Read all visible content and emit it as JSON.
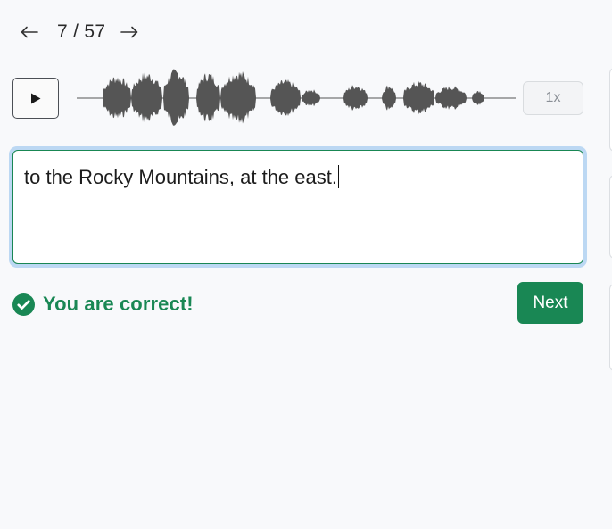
{
  "pager": {
    "current": "7",
    "total": "57",
    "display": "7 / 57"
  },
  "audio": {
    "play_icon": "play-icon",
    "speed": "1x"
  },
  "answer": {
    "value": "to the Rocky Mountains, at the east."
  },
  "feedback": {
    "icon": "check-circle-icon",
    "text": "You are correct!",
    "color": "#198754"
  },
  "actions": {
    "next_label": "Next"
  },
  "colors": {
    "accent": "#198754",
    "focus_ring": "#bcd8f3",
    "waveform": "#555555"
  }
}
